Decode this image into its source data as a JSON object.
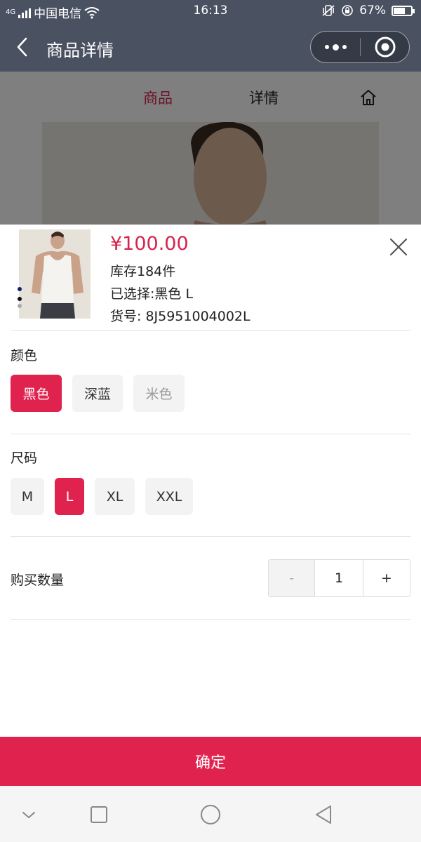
{
  "status_bar": {
    "carrier": "中国电信",
    "network": "4G",
    "time": "16:13",
    "battery": "67%",
    "battery_level": 0.67
  },
  "nav": {
    "title": "商品详情",
    "back_icon": "chevron-left-icon",
    "more_icon": "more-dots-icon",
    "close_icon": "target-circle-icon"
  },
  "page": {
    "tabs": [
      "商品",
      "详情"
    ],
    "active_tab": "商品",
    "home_icon": "home-icon"
  },
  "sheet": {
    "price": "¥100.00",
    "stock": "库存184件",
    "selected": "已选择:黑色 L",
    "sku": "货号: 8J5951004002L",
    "color_label": "颜色",
    "colors": [
      {
        "label": "黑色",
        "state": "active"
      },
      {
        "label": "深蓝",
        "state": "normal"
      },
      {
        "label": "米色",
        "state": "disabled"
      }
    ],
    "size_label": "尺码",
    "sizes": [
      {
        "label": "M",
        "state": "normal"
      },
      {
        "label": "L",
        "state": "active"
      },
      {
        "label": "XL",
        "state": "normal"
      },
      {
        "label": "XXL",
        "state": "normal"
      }
    ],
    "quantity_label": "购买数量",
    "quantity": "1",
    "minus": "-",
    "plus": "+",
    "confirm": "确定"
  },
  "colors": {
    "accent": "#e0224f",
    "header": "#4a5161"
  }
}
